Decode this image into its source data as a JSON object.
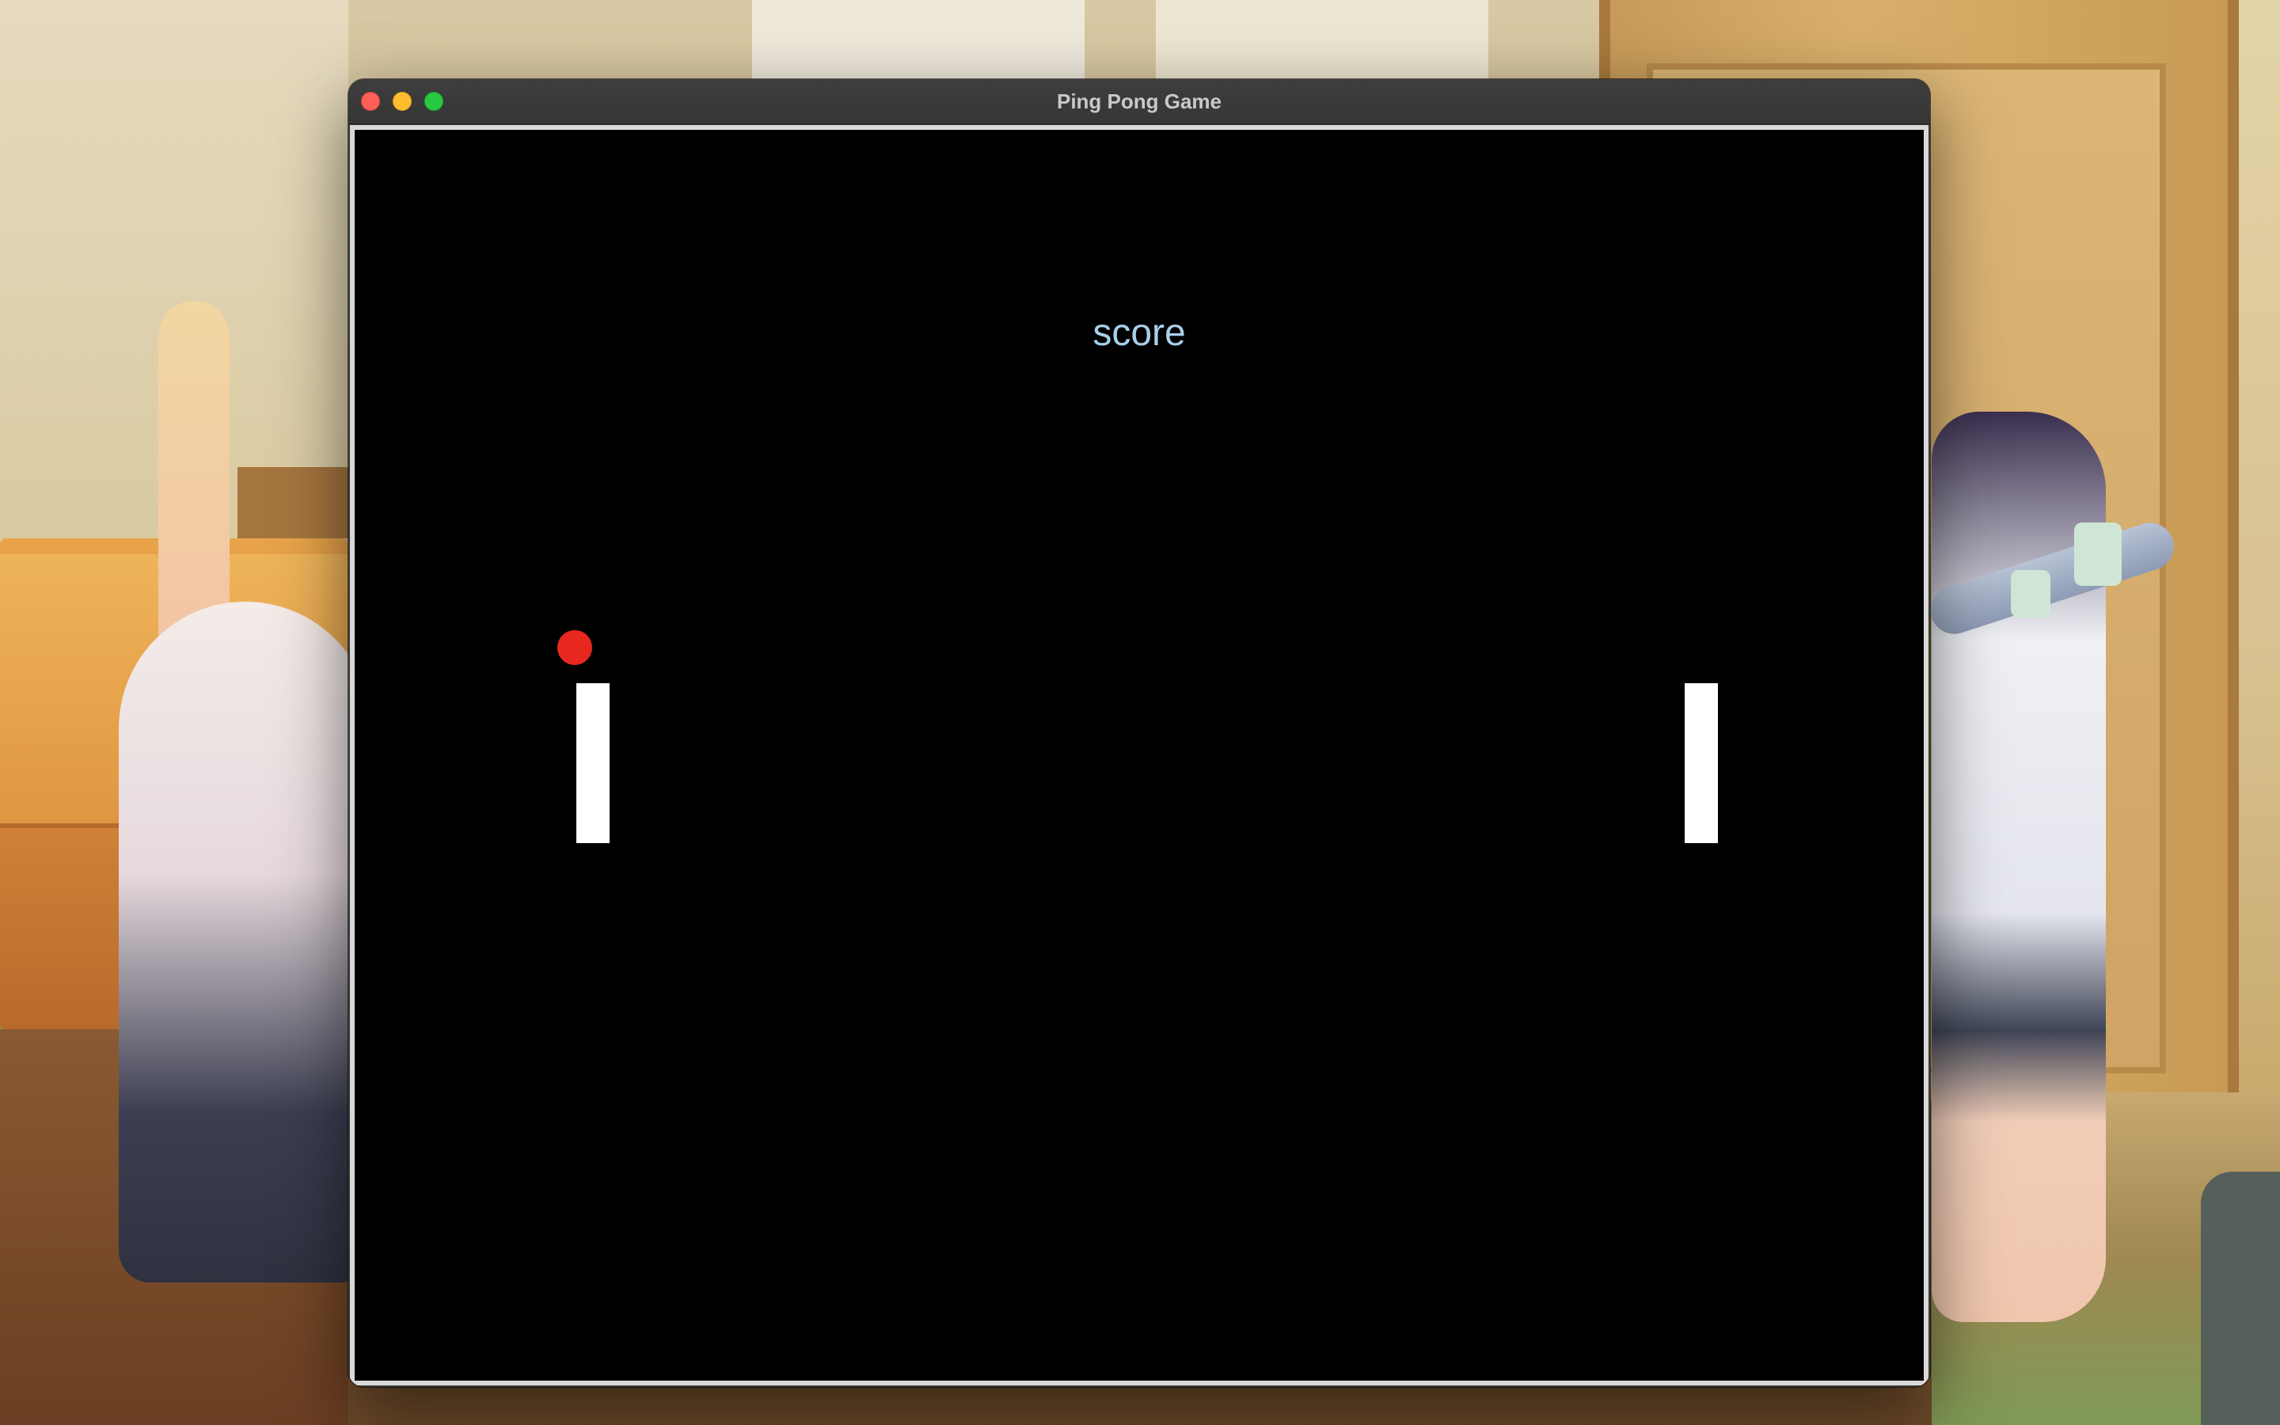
{
  "window": {
    "title": "Ping Pong Game"
  },
  "game": {
    "score_label": "score",
    "ball_color": "#e8281e",
    "paddle_color": "#ffffff",
    "background_color": "#000000",
    "score_color": "#a8cfe8"
  },
  "traffic_lights": {
    "close_color": "#fe5f57",
    "minimize_color": "#febc2e",
    "zoom_color": "#28c840"
  }
}
